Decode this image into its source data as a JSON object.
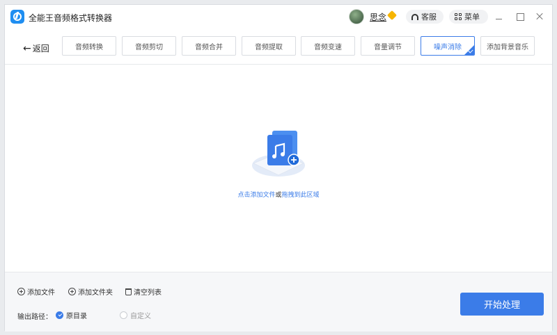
{
  "app": {
    "title": "全能王音频格式转换器",
    "accent": "#3b7ce8"
  },
  "user": {
    "name": "思念"
  },
  "header": {
    "service_label": "客服",
    "menu_label": "菜单"
  },
  "nav": {
    "back_label": "返回",
    "tabs": [
      {
        "label": "音频转换",
        "active": false
      },
      {
        "label": "音频剪切",
        "active": false
      },
      {
        "label": "音频合并",
        "active": false
      },
      {
        "label": "音频提取",
        "active": false
      },
      {
        "label": "音频变速",
        "active": false
      },
      {
        "label": "音量调节",
        "active": false
      },
      {
        "label": "噪声消除",
        "active": true
      },
      {
        "label": "添加背景音乐",
        "active": false
      }
    ]
  },
  "dropzone": {
    "hint_add": "点击添加文件",
    "hint_or": "或",
    "hint_drag": "拖拽到此区域"
  },
  "actions": {
    "add_file": "添加文件",
    "add_folder": "添加文件夹",
    "clear_list": "清空列表"
  },
  "output": {
    "label": "输出路径：",
    "options": [
      {
        "label": "原目录",
        "selected": true
      },
      {
        "label": "自定义",
        "selected": false
      }
    ]
  },
  "start_button": "开始处理"
}
